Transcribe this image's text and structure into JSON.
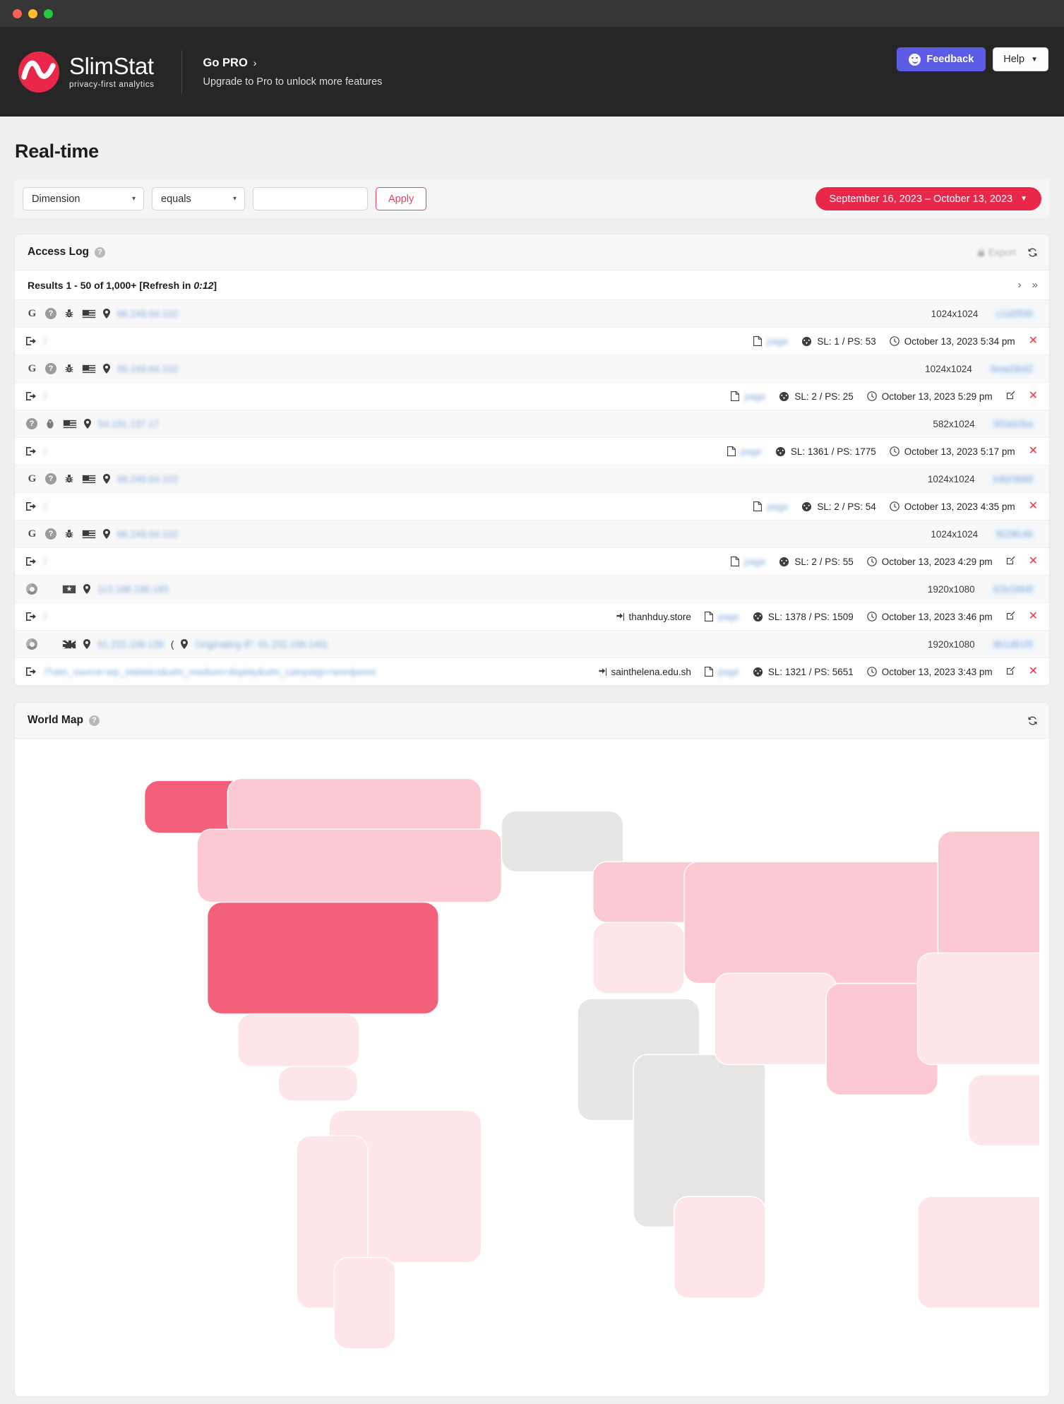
{
  "window": {
    "traffic_lights": [
      "close",
      "minimize",
      "maximize"
    ]
  },
  "header": {
    "logo_name": "SlimStat",
    "logo_tagline": "privacy-first analytics",
    "pro_link": "Go PRO",
    "pro_chevron": "›",
    "pro_subtitle": "Upgrade to Pro to unlock more features",
    "feedback_label": "Feedback",
    "help_label": "Help",
    "help_caret": "▼",
    "accent_color": "#e8274b",
    "feedback_color": "#5b5be6"
  },
  "page": {
    "title": "Real-time"
  },
  "filters": {
    "dimension_value": "Dimension",
    "operator_value": "equals",
    "value_input": "",
    "value_placeholder": "",
    "apply_label": "Apply",
    "date_range": "September 16, 2023 – October 13, 2023",
    "date_caret": "▼"
  },
  "access_log": {
    "title": "Access Log",
    "help_glyph": "?",
    "export_label": "Export",
    "results_prefix": "Results 1 - 50 of 1,000+ [Refresh in ",
    "results_timer": "0:12",
    "results_suffix": "]",
    "pager_next": "›",
    "pager_last": "»",
    "rows": [
      {
        "browser_icon": "google-icon",
        "platform_icon": "unknown-os-icon",
        "extra_icon": "bug-icon",
        "flag": "flag-us",
        "ip": "66.249.64.102",
        "resolution": "1024x1024",
        "hash": "c1d2ff35",
        "url": "/",
        "referrer": "",
        "sl_ps": "SL: 1 / PS: 53",
        "timestamp": "October 13, 2023 5:34 pm",
        "has_edit": false
      },
      {
        "browser_icon": "google-icon",
        "platform_icon": "unknown-os-icon",
        "extra_icon": "bug-icon",
        "flag": "flag-us",
        "ip": "66.249.64.102",
        "resolution": "1024x1024",
        "hash": "8ead3bd2",
        "url": "/",
        "referrer": "",
        "sl_ps": "SL: 2 / PS: 25",
        "timestamp": "October 13, 2023 5:29 pm",
        "has_edit": true
      },
      {
        "browser_icon": "unknown-browser-icon",
        "platform_icon": "linux-icon",
        "extra_icon": "",
        "flag": "flag-us",
        "ip": "54.191.137.17",
        "resolution": "582x1024",
        "hash": "9f2a92ba",
        "url": "/",
        "referrer": "",
        "sl_ps": "SL: 1361 / PS: 1775",
        "timestamp": "October 13, 2023 5:17 pm",
        "has_edit": false
      },
      {
        "browser_icon": "google-icon",
        "platform_icon": "unknown-os-icon",
        "extra_icon": "bug-icon",
        "flag": "flag-us",
        "ip": "66.249.64.102",
        "resolution": "1024x1024",
        "hash": "b9bf3b88",
        "url": "/",
        "referrer": "",
        "sl_ps": "SL: 2 / PS: 54",
        "timestamp": "October 13, 2023 4:35 pm",
        "has_edit": false
      },
      {
        "browser_icon": "google-icon",
        "platform_icon": "unknown-os-icon",
        "extra_icon": "bug-icon",
        "flag": "flag-us",
        "ip": "66.249.64.102",
        "resolution": "1024x1024",
        "hash": "f629fc46",
        "url": "/",
        "referrer": "",
        "sl_ps": "SL: 2 / PS: 55",
        "timestamp": "October 13, 2023 4:29 pm",
        "has_edit": true
      },
      {
        "browser_icon": "chrome-icon",
        "platform_icon": "windows-icon",
        "extra_icon": "",
        "flag": "flag-vn",
        "ip": "113.188.196.185",
        "resolution": "1920x1080",
        "hash": "82b1884f",
        "url": "/",
        "referrer": "thanhduy.store",
        "sl_ps": "SL: 1378 / PS: 1509",
        "timestamp": "October 13, 2023 3:46 pm",
        "has_edit": true
      },
      {
        "browser_icon": "chrome-icon",
        "platform_icon": "windows-icon",
        "extra_icon": "",
        "flag": "flag-uk",
        "ip": "91.232.198.139",
        "origin_ip": "( Originating IP: 91.232.198.140)",
        "resolution": "1920x1080",
        "hash": "8b1d61f5",
        "url": "/?utm_source=wp_statistics&utm_medium=display&utm_campaign=wordpress",
        "referrer": "sainthelena.edu.sh",
        "sl_ps": "SL: 1321 / PS: 5651",
        "timestamp": "October 13, 2023 3:43 pm",
        "has_edit": true
      }
    ],
    "page_link_label": "page"
  },
  "world_map": {
    "title": "World Map",
    "help_glyph": "?",
    "legend_color_high": "#f2607b",
    "legend_color_mid": "#fcc8d3",
    "legend_color_low": "#fde5ea",
    "legend_color_none": "#e8e6e4"
  }
}
